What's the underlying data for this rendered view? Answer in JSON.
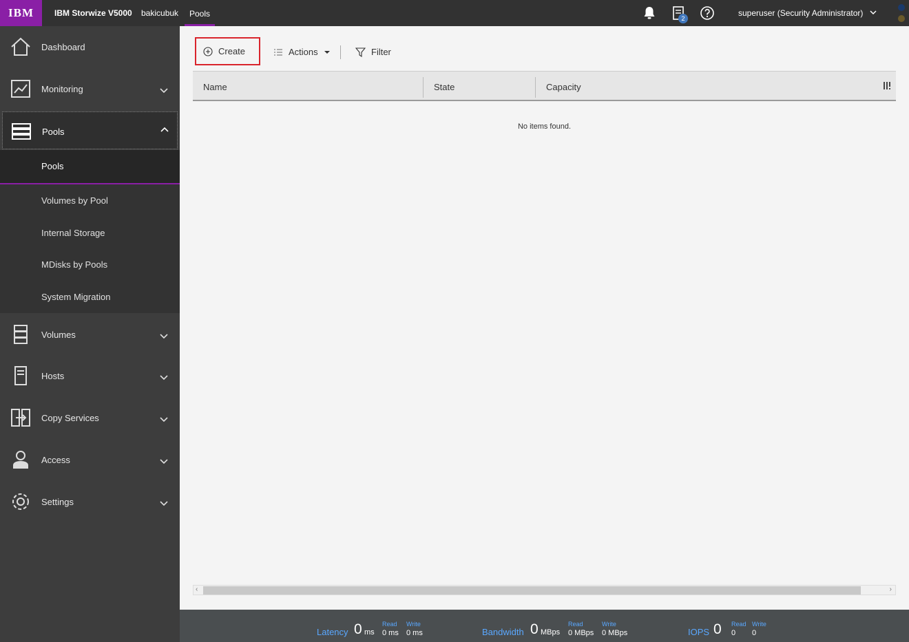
{
  "header": {
    "logo": "IBM",
    "product": "IBM Storwize V5000",
    "system_name": "bakicubuk",
    "breadcrumb": "Pools",
    "tasks_badge": "2",
    "user": "superuser (Security Administrator)"
  },
  "sidebar": {
    "items": [
      {
        "label": "Dashboard",
        "icon": "home-icon"
      },
      {
        "label": "Monitoring",
        "icon": "monitoring-icon"
      },
      {
        "label": "Pools",
        "icon": "pools-icon"
      },
      {
        "label": "Volumes",
        "icon": "volumes-icon"
      },
      {
        "label": "Hosts",
        "icon": "hosts-icon"
      },
      {
        "label": "Copy Services",
        "icon": "copy-services-icon"
      },
      {
        "label": "Access",
        "icon": "access-icon"
      },
      {
        "label": "Settings",
        "icon": "gear-icon"
      }
    ],
    "pools_submenu": [
      "Pools",
      "Volumes by Pool",
      "Internal Storage",
      "MDisks by Pools",
      "System Migration"
    ]
  },
  "toolbar": {
    "create_label": "Create",
    "actions_label": "Actions",
    "filter_label": "Filter"
  },
  "table": {
    "columns": [
      "Name",
      "State",
      "Capacity"
    ],
    "empty_message": "No items found."
  },
  "status": {
    "latency": {
      "label": "Latency",
      "value": "0",
      "unit": "ms",
      "read_label": "Read",
      "read_value": "0 ms",
      "write_label": "Write",
      "write_value": "0 ms"
    },
    "bandwidth": {
      "label": "Bandwidth",
      "value": "0",
      "unit": "MBps",
      "read_label": "Read",
      "read_value": "0 MBps",
      "write_label": "Write",
      "write_value": "0 MBps"
    },
    "iops": {
      "label": "IOPS",
      "value": "0",
      "read_label": "Read",
      "read_value": "0",
      "write_label": "Write",
      "write_value": "0"
    }
  },
  "colors": {
    "brand_purple": "#8a1fa6",
    "highlight_red": "#d9242c",
    "metric_blue": "#5aa8ff"
  }
}
